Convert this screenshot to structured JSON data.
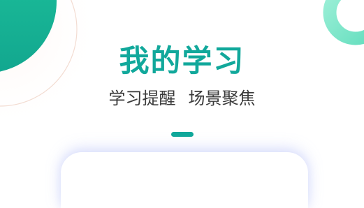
{
  "title": "我的学习",
  "subtitle": {
    "part1": "学习提醒",
    "part2": "场景聚焦"
  },
  "colors": {
    "brand": "#0fa79a",
    "title": "#11a89b",
    "subtitle": "#3a3a3a",
    "indicator": "#10a89a",
    "circle_gradient_start": "#1fc49c",
    "circle_gradient_end": "#12a78f",
    "ring_gradient_start": "#9ef0d8",
    "ring_gradient_end": "#62ddbd",
    "outline_arc": "#f3dcd2"
  },
  "pager": {
    "active_index": 0
  }
}
